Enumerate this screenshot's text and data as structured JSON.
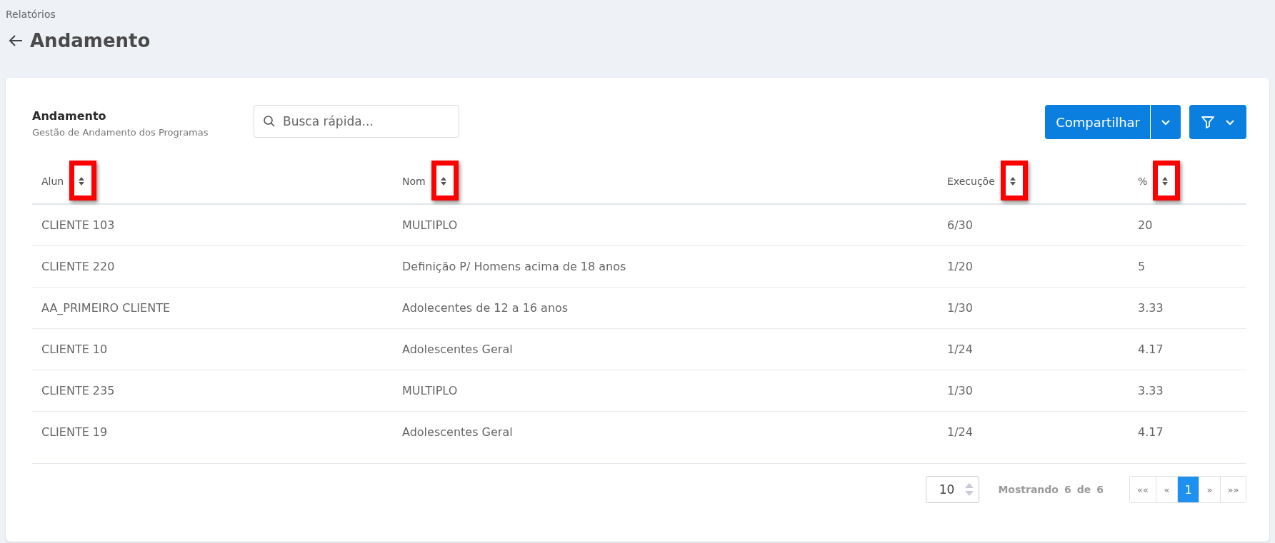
{
  "breadcrumb": "Relatórios",
  "page_title": "Andamento",
  "card": {
    "title": "Andamento",
    "subtitle": "Gestão de Andamento dos Programas"
  },
  "search": {
    "placeholder": "Busca rápida..."
  },
  "share_button": {
    "label": "Compartilhar"
  },
  "table": {
    "columns": [
      {
        "label": "Alun",
        "highlighted": true
      },
      {
        "label": "Nom",
        "highlighted": true
      },
      {
        "label": "Execuçõe",
        "highlighted": true
      },
      {
        "label": "%",
        "highlighted": true
      }
    ],
    "rows": [
      [
        "CLIENTE 103",
        "MULTIPLO",
        "6/30",
        "20"
      ],
      [
        "CLIENTE 220",
        "Definição P/ Homens acima de 18 anos",
        "1/20",
        "5"
      ],
      [
        "AA_PRIMEIRO CLIENTE",
        "Adolecentes de 12 a 16 anos",
        "1/30",
        "3.33"
      ],
      [
        "CLIENTE 10",
        "Adolescentes Geral",
        "1/24",
        "4.17"
      ],
      [
        "CLIENTE 235",
        "MULTIPLO",
        "1/30",
        "3.33"
      ],
      [
        "CLIENTE 19",
        "Adolescentes Geral",
        "1/24",
        "4.17"
      ]
    ]
  },
  "pagination": {
    "page_size": "10",
    "showing": [
      "Mostrando",
      "6",
      "de",
      "6"
    ],
    "pages": [
      {
        "label": "««",
        "selected": false
      },
      {
        "label": "«",
        "selected": false
      },
      {
        "label": "1",
        "selected": true
      },
      {
        "label": "»",
        "selected": false
      },
      {
        "label": "»»",
        "selected": false
      }
    ]
  }
}
